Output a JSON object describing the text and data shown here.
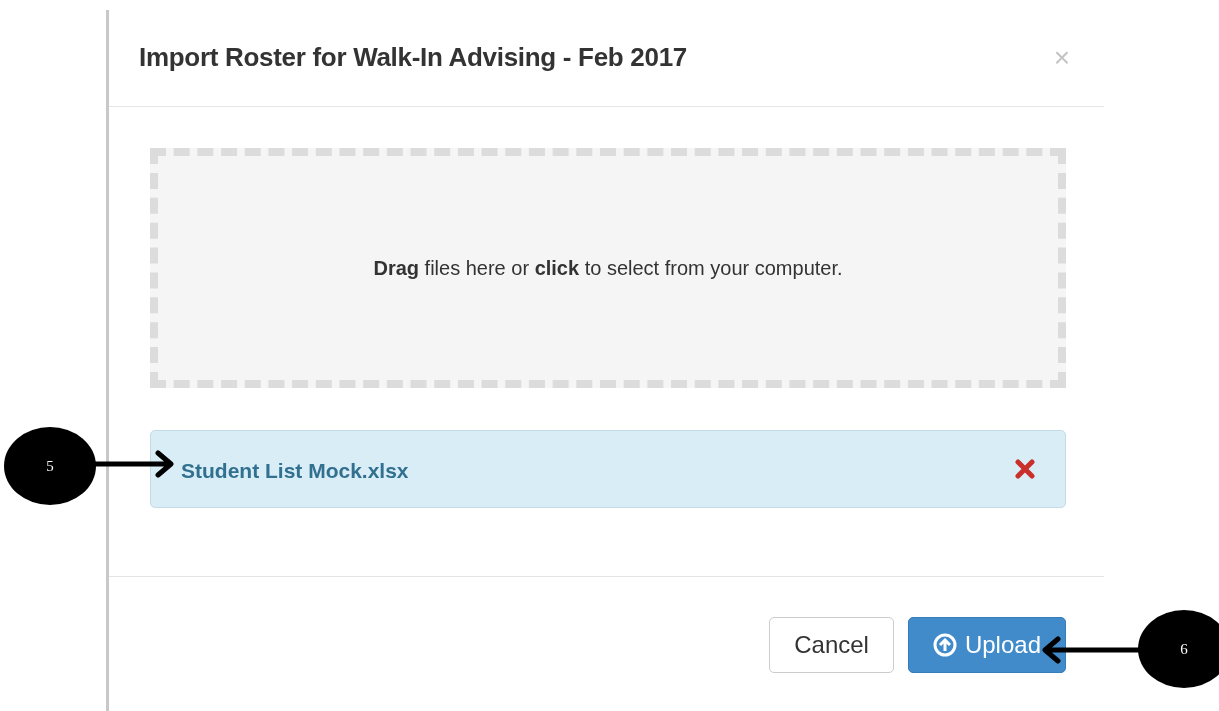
{
  "modal": {
    "title": "Import Roster for Walk-In Advising - Feb 2017",
    "close": "×"
  },
  "dropzone": {
    "text": "**Drag** files here or **click** to select from your computer."
  },
  "files": [
    {
      "name": "Student List Mock.xlsx"
    }
  ],
  "buttons": [
    {
      "label": "Cancel",
      "kind": "default"
    },
    {
      "label": "Upload",
      "kind": "primary"
    }
  ],
  "callouts": [
    {
      "label": "5",
      "kind": "left"
    },
    {
      "label": "6",
      "kind": "right"
    }
  ]
}
